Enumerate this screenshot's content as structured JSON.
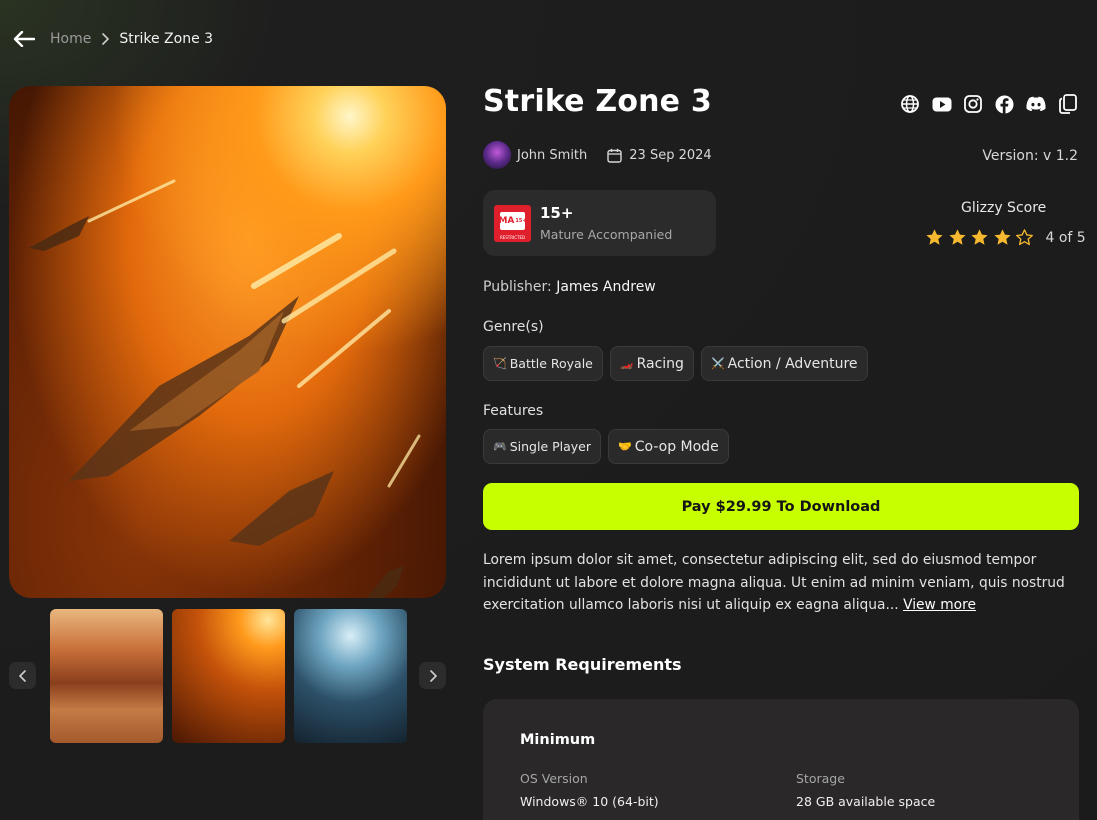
{
  "breadcrumb": {
    "home": "Home",
    "current": "Strike Zone 3"
  },
  "game": {
    "title": "Strike Zone 3",
    "author": "John Smith",
    "date": "23 Sep 2024",
    "version": "Version: v 1.2",
    "age_rating": {
      "badge": "MA",
      "badge_small": "15+",
      "badge_caption": "RESTRICTED",
      "age": "15+",
      "label": "Mature Accompanied"
    },
    "score": {
      "label": "Glizzy Score",
      "rating": 4,
      "max": 5,
      "text": "4 of 5"
    },
    "publisher": {
      "label": "Publisher:",
      "name": "James Andrew"
    }
  },
  "socials": [
    "globe-icon",
    "youtube-icon",
    "instagram-icon",
    "facebook-icon",
    "discord-icon",
    "copy-icon"
  ],
  "genres": {
    "label": "Genre(s)",
    "items": [
      {
        "emoji": "🏹",
        "label": "Battle Royale"
      },
      {
        "emoji": "🏎️",
        "label": "Racing"
      },
      {
        "emoji": "⚔️",
        "label": "Action / Adventure"
      }
    ]
  },
  "features": {
    "label": "Features",
    "items": [
      {
        "emoji": "🎮",
        "label": "Single Player"
      },
      {
        "emoji": "🤝",
        "label": "Co-op Mode"
      }
    ]
  },
  "pay_button": "Pay $29.99 To Download",
  "description": {
    "text": "Lorem ipsum dolor sit amet, consectetur adipiscing elit, sed do eiusmod tempor incididunt ut labore et dolore magna aliqua. Ut enim ad minim veniam, quis nostrud exercitation ullamco laboris nisi ut aliquip ex eagna aliqua...",
    "view_more": "View more"
  },
  "system_requirements": {
    "title": "System Requirements",
    "minimum": {
      "heading": "Minimum",
      "os_label": "OS Version",
      "os_value": "Windows® 10 (64-bit)",
      "storage_label": "Storage",
      "storage_value": "28 GB available space"
    }
  },
  "colors": {
    "accent": "#c8ff00",
    "star": "#f5b82e",
    "background": "#1c1b1b"
  }
}
